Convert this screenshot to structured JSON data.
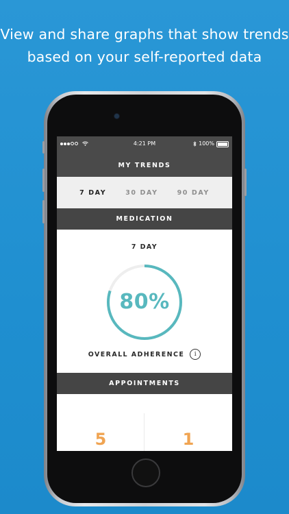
{
  "promo": {
    "line1": "View and share graphs that show trends",
    "line2": "based on your self-reported data"
  },
  "status_bar": {
    "time": "4:21 PM",
    "battery": "100%"
  },
  "header": {
    "title": "MY TRENDS"
  },
  "tabs": [
    {
      "label": "7 DAY",
      "active": true
    },
    {
      "label": "30 DAY",
      "active": false
    },
    {
      "label": "90 DAY",
      "active": false
    }
  ],
  "medication": {
    "section_title": "MEDICATION",
    "period": "7 DAY",
    "adherence_value": "80%",
    "adherence_fraction": 0.8,
    "adherence_label": "OVERALL ADHERENCE",
    "info_symbol": "i"
  },
  "appointments": {
    "section_title": "APPOINTMENTS",
    "values": [
      "5",
      "1"
    ]
  },
  "colors": {
    "background": "#1f8fd0",
    "header": "#4a4a4a",
    "ring": "#58b8be",
    "ring_track": "#eeeeee",
    "appointment_number": "#f0a452"
  },
  "icons": [
    "wifi-icon",
    "bluetooth-icon",
    "battery-icon",
    "info-icon"
  ]
}
